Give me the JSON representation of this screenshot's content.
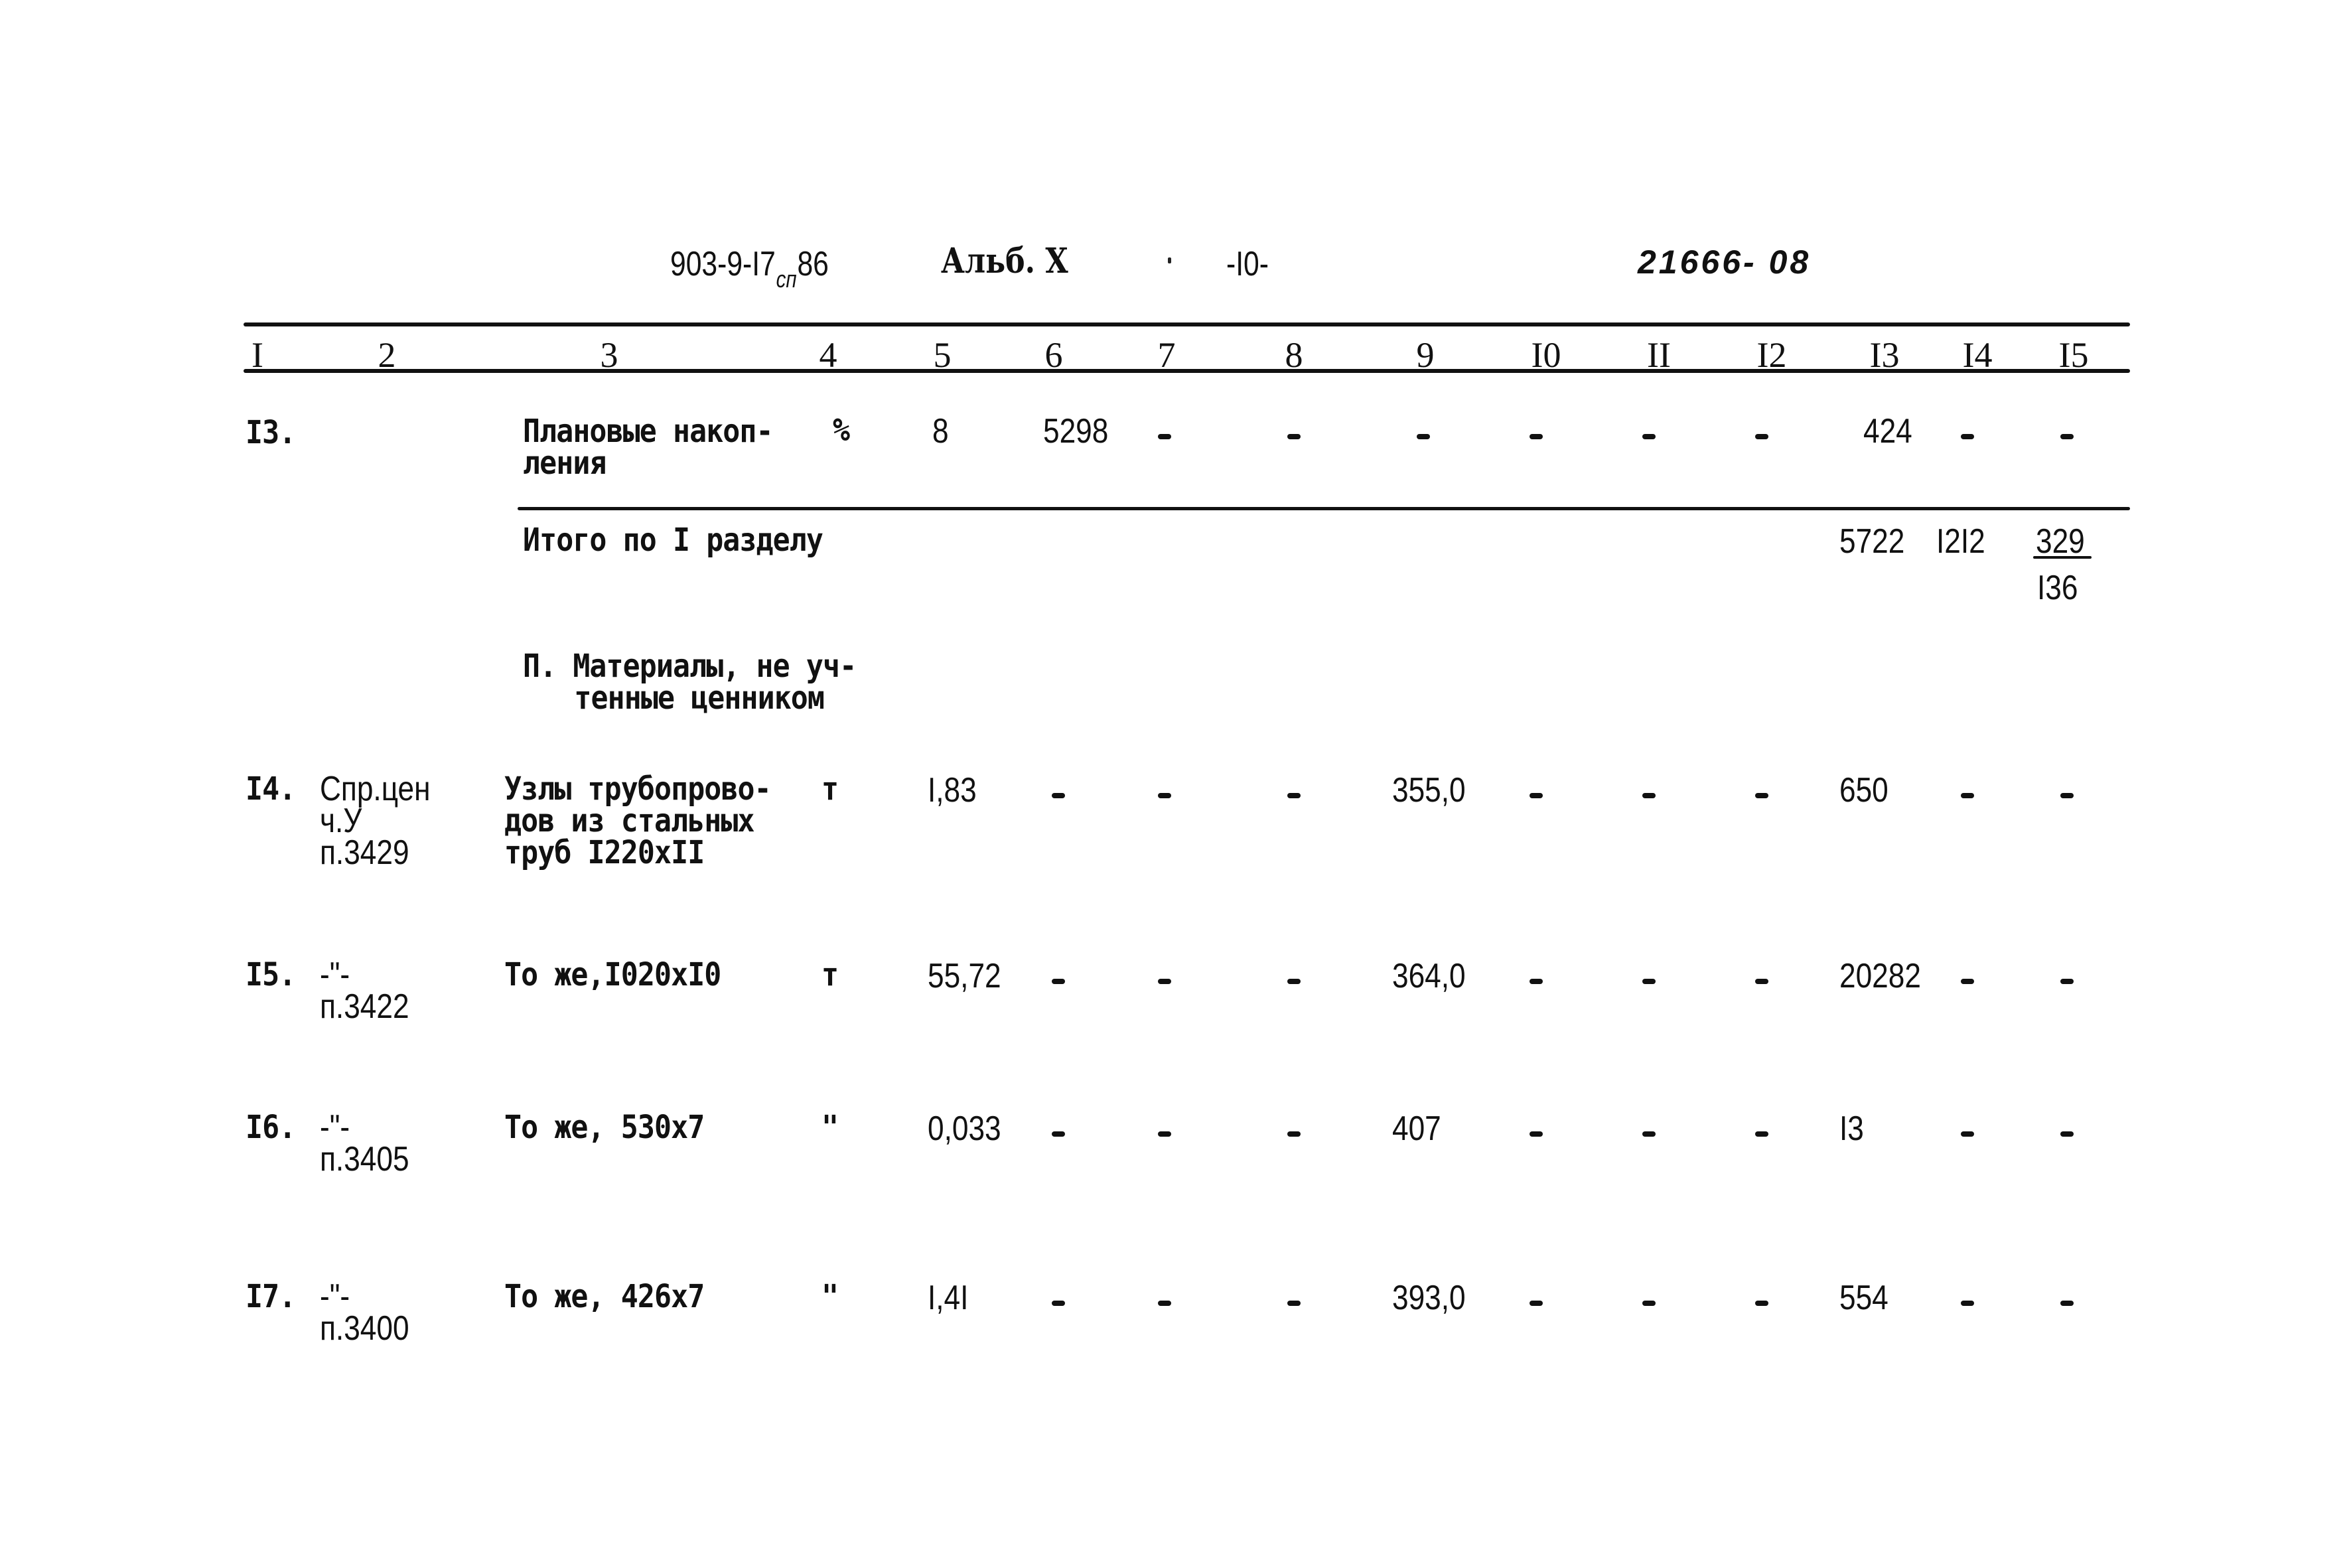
{
  "header": {
    "doc_code_prefix": "903-9-I7",
    "doc_code_sub": "сп",
    "doc_code_suffix": "86",
    "album": "Альб. X",
    "page": "-I0-",
    "handwritten_number": "21666- 08"
  },
  "columns": [
    "I",
    "2",
    "3",
    "4",
    "5",
    "6",
    "7",
    "8",
    "9",
    "I0",
    "II",
    "I2",
    "I3",
    "I4",
    "I5"
  ],
  "rows": [
    {
      "num": "I3.",
      "ref": [],
      "name": [
        "Плановые накоп-",
        "ления"
      ],
      "unit": "%",
      "c5": "8",
      "c6": "5298",
      "c7": "-",
      "c8": "-",
      "c9": "-",
      "c10": "-",
      "c11": "-",
      "c12": "-",
      "c13": "424",
      "c14": "-",
      "c15": "-"
    }
  ],
  "total": {
    "label": "Итого по I разделу",
    "c13": "5722",
    "c14": "I2I2",
    "c15_numerator": "329",
    "c15_denominator": "I36"
  },
  "section2": {
    "title": [
      "П. Материалы, не уч-",
      "тенные ценником"
    ]
  },
  "items": [
    {
      "num": "I4.",
      "ref": [
        "Спр.цен",
        "ч.У",
        "п.3429"
      ],
      "name": [
        "Узлы трубопрово-",
        "дов из стальных",
        "труб I220xII"
      ],
      "unit": "т",
      "c5": "I,83",
      "c6": "-",
      "c7": "-",
      "c8": "-",
      "c9": "355,0",
      "c10": "-",
      "c11": "-",
      "c12": "-",
      "c13": "650",
      "c14": "-",
      "c15": "-"
    },
    {
      "num": "I5.",
      "ref": [
        "-\"-",
        "п.3422"
      ],
      "name": [
        "То же,I020xI0"
      ],
      "unit": "т",
      "c5": "55,72",
      "c6": "-",
      "c7": "-",
      "c8": "-",
      "c9": "364,0",
      "c10": "-",
      "c11": "-",
      "c12": "-",
      "c13": "20282",
      "c14": "-",
      "c15": "-"
    },
    {
      "num": "I6.",
      "ref": [
        "-\"-",
        "п.3405"
      ],
      "name": [
        "То же, 530x7"
      ],
      "unit": "\"",
      "c5": "0,033",
      "c6": "-",
      "c7": "-",
      "c8": "-",
      "c9": "407",
      "c10": "-",
      "c11": "-",
      "c12": "-",
      "c13": "I3",
      "c14": "-",
      "c15": "-"
    },
    {
      "num": "I7.",
      "ref": [
        "-\"-",
        "п.3400"
      ],
      "name": [
        "То же, 426x7"
      ],
      "unit": "\"",
      "c5": "I,4I",
      "c6": "-",
      "c7": "-",
      "c8": "-",
      "c9": "393,0",
      "c10": "-",
      "c11": "-",
      "c12": "-",
      "c13": "554",
      "c14": "-",
      "c15": "-"
    }
  ]
}
